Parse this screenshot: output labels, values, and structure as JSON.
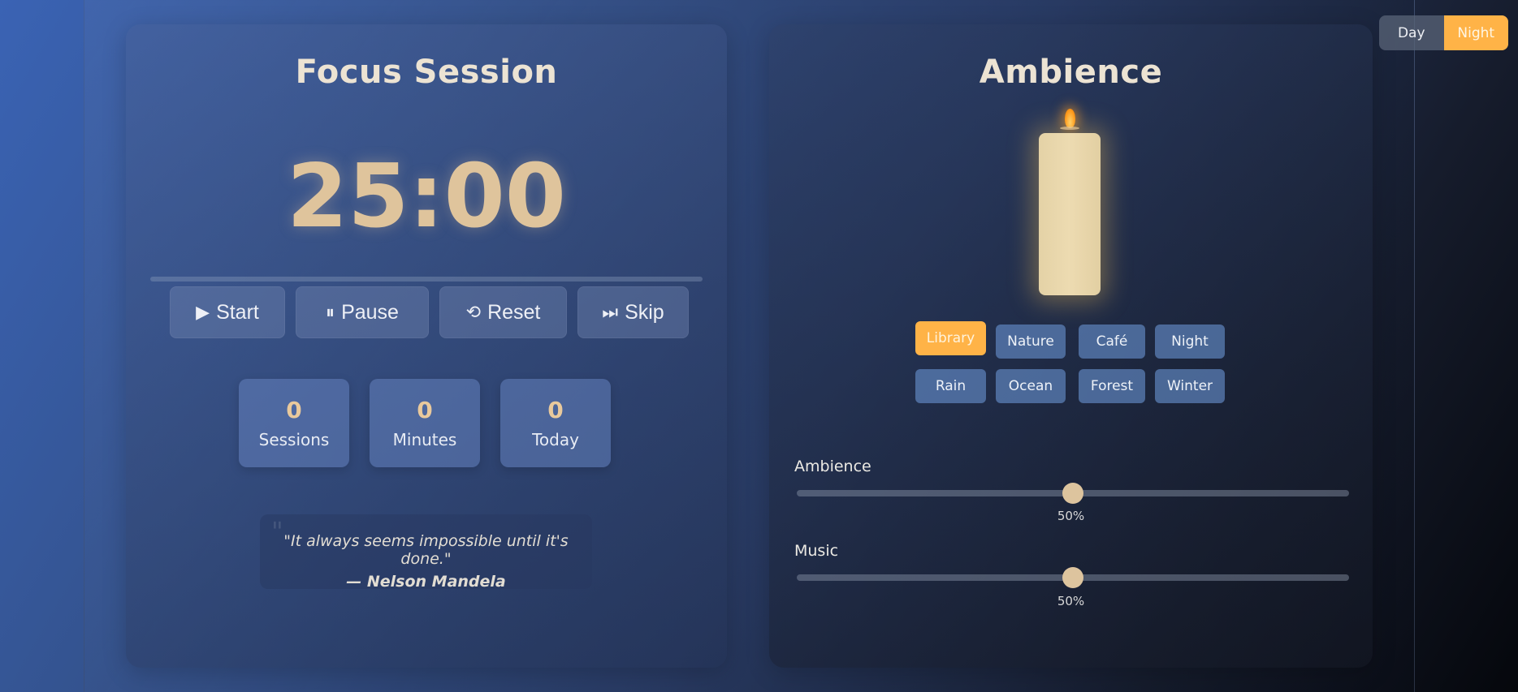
{
  "focus": {
    "title": "Focus Session",
    "timer": "25:00",
    "progress": 0,
    "controls": [
      {
        "icon": "▶",
        "label": "Start"
      },
      {
        "icon": "⏸",
        "label": "Pause"
      },
      {
        "icon": "⟲",
        "label": "Reset"
      },
      {
        "icon": "⏭",
        "label": "Skip"
      }
    ],
    "stats": [
      {
        "value": "0",
        "label": "Sessions"
      },
      {
        "value": "0",
        "label": "Minutes"
      },
      {
        "value": "0",
        "label": "Today"
      }
    ],
    "quote": {
      "text": "\"It always seems impossible until it's done.\"",
      "author": "— Nelson Mandela"
    }
  },
  "ambience": {
    "title": "Ambience",
    "sounds": [
      "Library",
      "Nature",
      "Café",
      "Night",
      "Rain",
      "Ocean",
      "Forest",
      "Winter"
    ],
    "active_sound": "Library",
    "sliders": [
      {
        "label": "Ambience",
        "value": 50,
        "display": "50%"
      },
      {
        "label": "Music",
        "value": 50,
        "display": "50%"
      }
    ]
  },
  "theme_toggle": {
    "day": "Day",
    "night": "Night",
    "active": "Night"
  },
  "colors": {
    "accent": "#ffb347",
    "timer": "#dfc49c",
    "stat_value": "#e9c99c"
  }
}
